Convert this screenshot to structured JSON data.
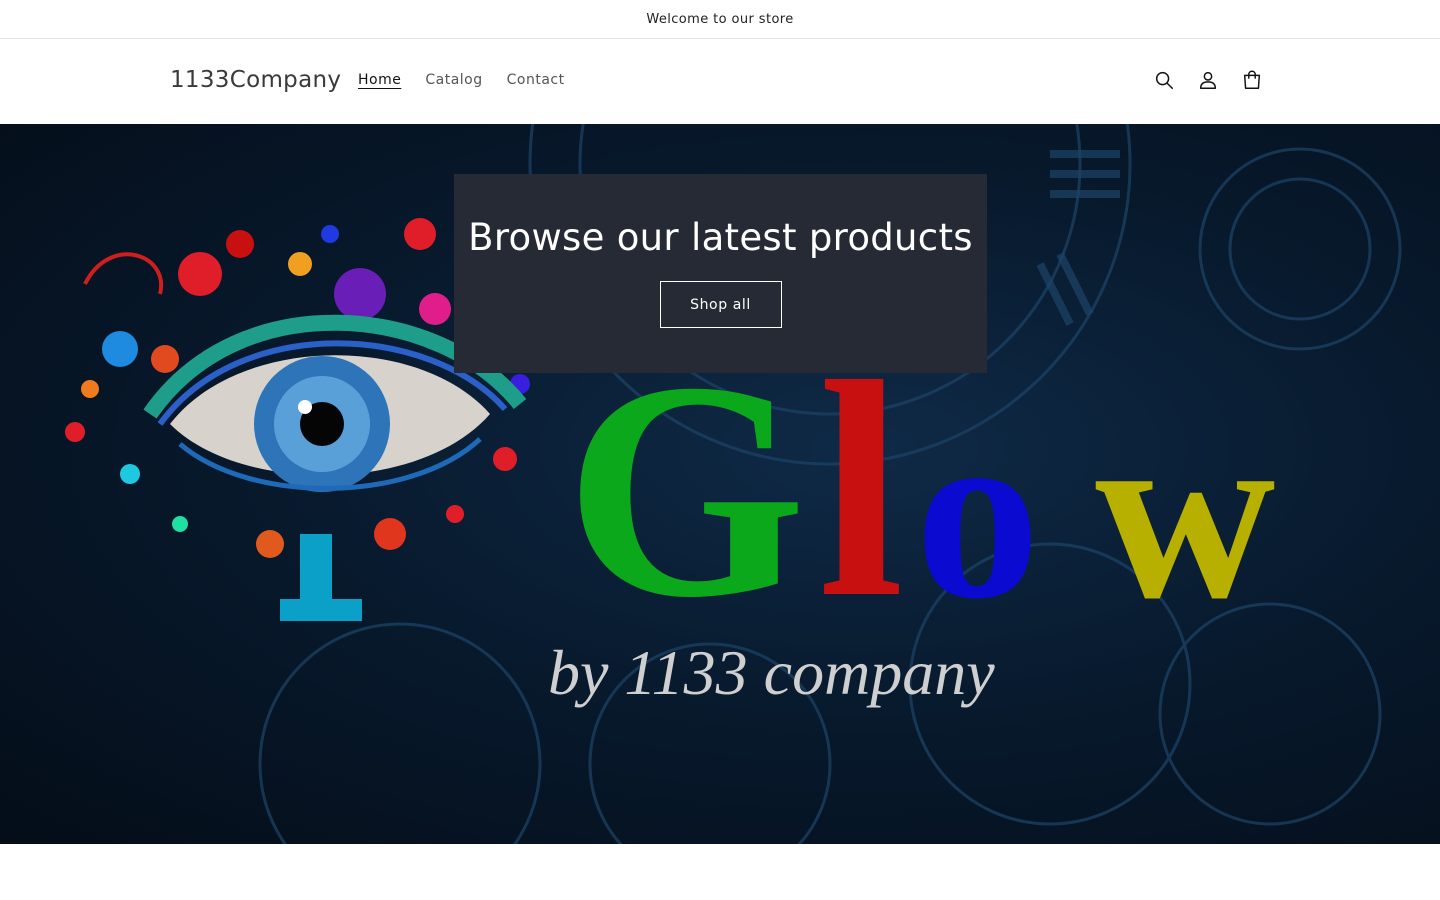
{
  "announcement": {
    "text": "Welcome to our store"
  },
  "header": {
    "logo": "1133Company",
    "nav": [
      {
        "label": "Home",
        "active": true
      },
      {
        "label": "Catalog",
        "active": false
      },
      {
        "label": "Contact",
        "active": false
      }
    ],
    "icons": [
      "search-icon",
      "account-icon",
      "cart-icon"
    ]
  },
  "hero": {
    "heading": "Browse our latest products",
    "button_label": "Shop all",
    "banner": {
      "wordmark": "Glow",
      "tagline": "by 1133 company",
      "colors": {
        "G": "#0aa81a",
        "l": "#c81010",
        "o": "#0a0ad0",
        "w": "#b8b000",
        "i": "#0aa0c8"
      }
    }
  }
}
